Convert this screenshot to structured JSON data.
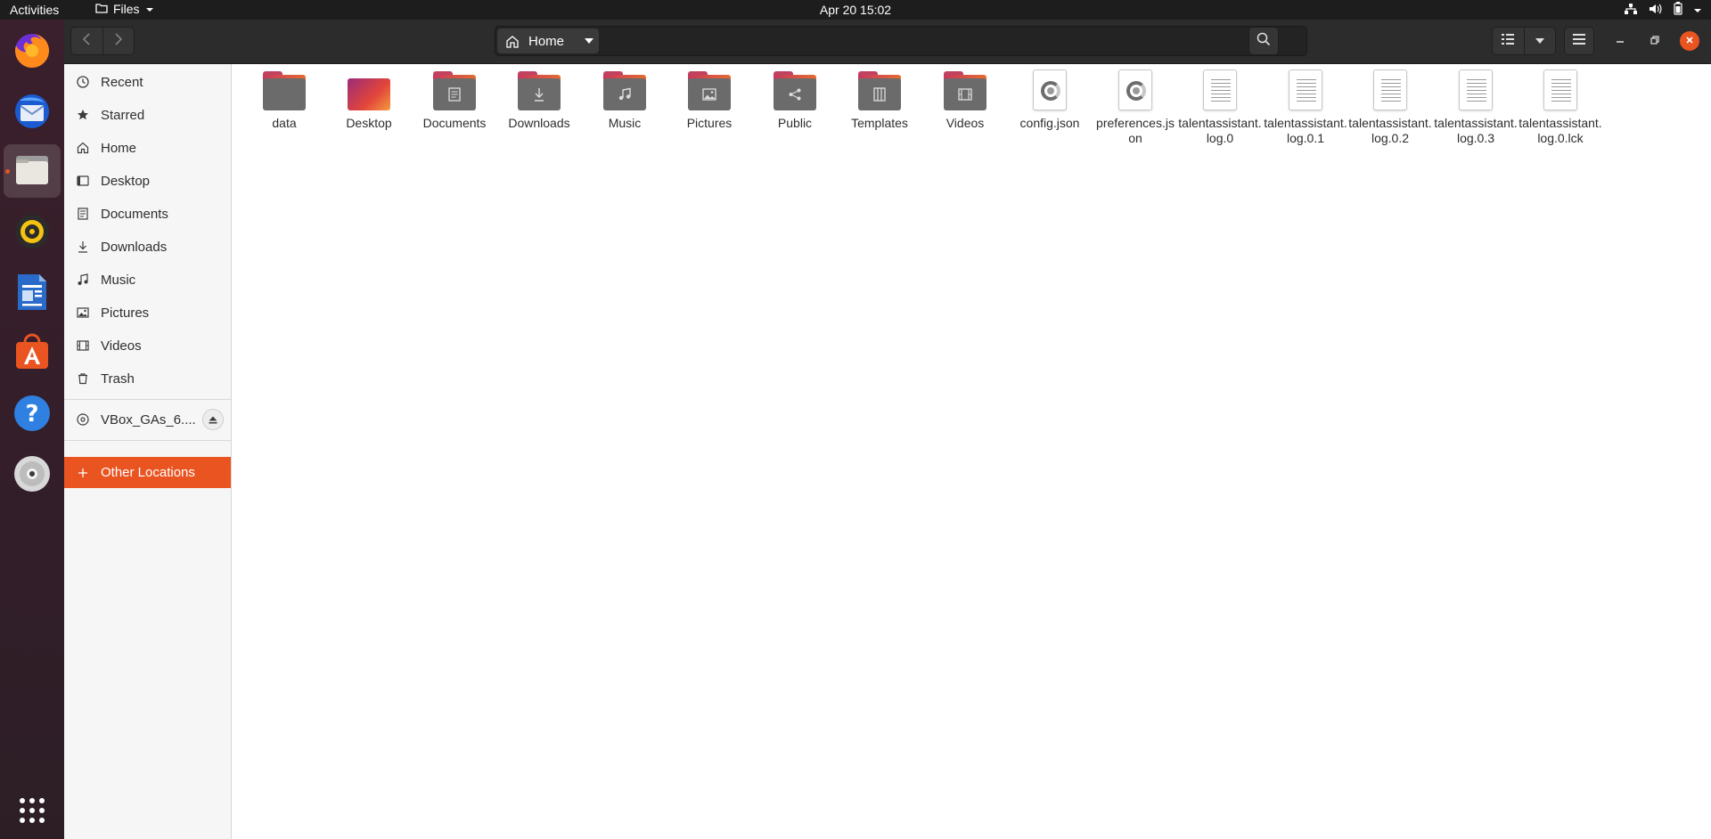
{
  "topbar": {
    "activities": "Activities",
    "app_name": "Files",
    "clock": "Apr 20  15:02"
  },
  "dock": {
    "items": [
      "firefox-icon",
      "thunderbird-icon",
      "files-icon",
      "rhythmbox-icon",
      "libreoffice-writer-icon",
      "software-center-icon",
      "help-icon",
      "dvd-icon",
      "show-apps-icon"
    ],
    "active": "files-icon"
  },
  "header": {
    "path_home": "Home"
  },
  "sidebar": {
    "items": [
      {
        "label": "Recent",
        "icon": "clock-icon"
      },
      {
        "label": "Starred",
        "icon": "star-icon"
      },
      {
        "label": "Home",
        "icon": "home-icon"
      },
      {
        "label": "Desktop",
        "icon": "desktop-icon"
      },
      {
        "label": "Documents",
        "icon": "document-icon"
      },
      {
        "label": "Downloads",
        "icon": "download-icon"
      },
      {
        "label": "Music",
        "icon": "music-icon"
      },
      {
        "label": "Pictures",
        "icon": "picture-icon"
      },
      {
        "label": "Videos",
        "icon": "video-icon"
      },
      {
        "label": "Trash",
        "icon": "trash-icon"
      }
    ],
    "device": {
      "label": "VBox_GAs_6....",
      "icon": "disc-icon"
    },
    "other_locations": "Other Locations"
  },
  "files": [
    {
      "name": "data",
      "kind": "folder"
    },
    {
      "name": "Desktop",
      "kind": "folder-desktop"
    },
    {
      "name": "Documents",
      "kind": "folder"
    },
    {
      "name": "Downloads",
      "kind": "folder"
    },
    {
      "name": "Music",
      "kind": "folder"
    },
    {
      "name": "Pictures",
      "kind": "folder"
    },
    {
      "name": "Public",
      "kind": "folder"
    },
    {
      "name": "Templates",
      "kind": "folder"
    },
    {
      "name": "Videos",
      "kind": "folder"
    },
    {
      "name": "config.json",
      "kind": "json"
    },
    {
      "name": "preferences.json",
      "kind": "json"
    },
    {
      "name": "talentassistant.log.0",
      "kind": "text"
    },
    {
      "name": "talentassistant.log.0.1",
      "kind": "text"
    },
    {
      "name": "talentassistant.log.0.2",
      "kind": "text"
    },
    {
      "name": "talentassistant.log.0.3",
      "kind": "text"
    },
    {
      "name": "talentassistant.log.0.lck",
      "kind": "text"
    }
  ],
  "colors": {
    "accent": "#e95420",
    "topbar": "#1d1d1d",
    "headerbar": "#2c2c2c"
  }
}
